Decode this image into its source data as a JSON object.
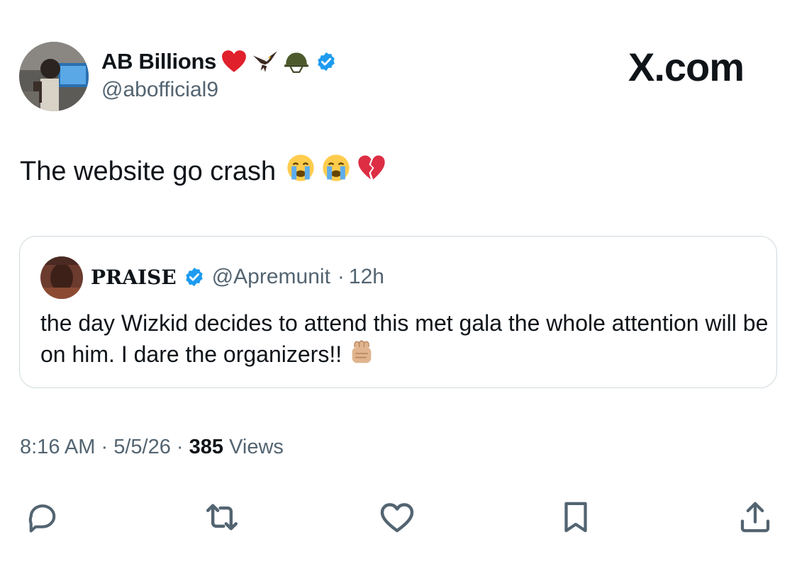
{
  "author": {
    "display_name": "AB Billions",
    "name_emojis": [
      "red-heart",
      "eagle",
      "military-helmet"
    ],
    "verified": true,
    "handle": "@abofficial9"
  },
  "brand": "X.com",
  "tweet": {
    "text": "The website go crash",
    "emojis": [
      "loudly-crying-face",
      "loudly-crying-face",
      "broken-heart"
    ]
  },
  "quoted": {
    "display_name": "PRAISE",
    "verified": true,
    "handle": "@Apremunit",
    "separator": "·",
    "age": "12h",
    "text": "the day Wizkid decides to attend this met gala the whole attention will be on him. I dare the organizers!!",
    "emoji": "oncoming-fist"
  },
  "meta": {
    "time": "8:16 AM",
    "date": "5/5/26",
    "views_count": "385",
    "views_label": "Views",
    "separator": "·"
  },
  "actions": {
    "icons": [
      "reply-icon",
      "retweet-icon",
      "like-icon",
      "bookmark-icon",
      "share-icon"
    ]
  },
  "colors": {
    "text": "#0f1419",
    "secondary": "#536471",
    "verified": "#1d9bf0",
    "border": "#cfd9de"
  }
}
